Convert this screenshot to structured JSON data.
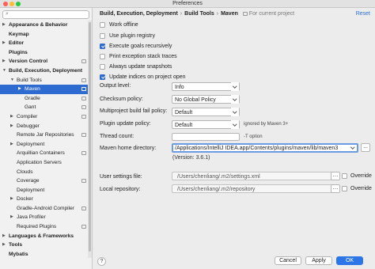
{
  "window": {
    "title": "Preferences"
  },
  "sidebar": {
    "items": [
      {
        "label": "Appearance & Behavior",
        "bold": true,
        "arrow": "▶",
        "indent": 0,
        "proj": false,
        "selected": false
      },
      {
        "label": "Keymap",
        "bold": true,
        "arrow": "",
        "indent": 0,
        "proj": false,
        "selected": false
      },
      {
        "label": "Editor",
        "bold": true,
        "arrow": "▶",
        "indent": 0,
        "proj": false,
        "selected": false
      },
      {
        "label": "Plugins",
        "bold": true,
        "arrow": "",
        "indent": 0,
        "proj": false,
        "selected": false
      },
      {
        "label": "Version Control",
        "bold": true,
        "arrow": "▶",
        "indent": 0,
        "proj": true,
        "selected": false
      },
      {
        "label": "Build, Execution, Deployment",
        "bold": true,
        "arrow": "▼",
        "indent": 0,
        "proj": false,
        "selected": false
      },
      {
        "label": "Build Tools",
        "bold": false,
        "arrow": "▼",
        "indent": 1,
        "proj": true,
        "selected": false
      },
      {
        "label": "Maven",
        "bold": false,
        "arrow": "▶",
        "indent": 2,
        "proj": true,
        "selected": true
      },
      {
        "label": "Gradle",
        "bold": false,
        "arrow": "",
        "indent": 2,
        "proj": true,
        "selected": false
      },
      {
        "label": "Gant",
        "bold": false,
        "arrow": "",
        "indent": 2,
        "proj": true,
        "selected": false
      },
      {
        "label": "Compiler",
        "bold": false,
        "arrow": "▶",
        "indent": 1,
        "proj": true,
        "selected": false
      },
      {
        "label": "Debugger",
        "bold": false,
        "arrow": "▶",
        "indent": 1,
        "proj": false,
        "selected": false
      },
      {
        "label": "Remote Jar Repositories",
        "bold": false,
        "arrow": "",
        "indent": 1,
        "proj": true,
        "selected": false
      },
      {
        "label": "Deployment",
        "bold": false,
        "arrow": "▶",
        "indent": 1,
        "proj": false,
        "selected": false
      },
      {
        "label": "Arquillian Containers",
        "bold": false,
        "arrow": "",
        "indent": 1,
        "proj": true,
        "selected": false
      },
      {
        "label": "Application Servers",
        "bold": false,
        "arrow": "",
        "indent": 1,
        "proj": false,
        "selected": false
      },
      {
        "label": "Clouds",
        "bold": false,
        "arrow": "",
        "indent": 1,
        "proj": false,
        "selected": false
      },
      {
        "label": "Coverage",
        "bold": false,
        "arrow": "",
        "indent": 1,
        "proj": true,
        "selected": false
      },
      {
        "label": "Deployment",
        "bold": false,
        "arrow": "",
        "indent": 1,
        "proj": false,
        "selected": false
      },
      {
        "label": "Docker",
        "bold": false,
        "arrow": "▶",
        "indent": 1,
        "proj": false,
        "selected": false
      },
      {
        "label": "Gradle-Android Compiler",
        "bold": false,
        "arrow": "",
        "indent": 1,
        "proj": true,
        "selected": false
      },
      {
        "label": "Java Profiler",
        "bold": false,
        "arrow": "▶",
        "indent": 1,
        "proj": false,
        "selected": false
      },
      {
        "label": "Required Plugins",
        "bold": false,
        "arrow": "",
        "indent": 1,
        "proj": true,
        "selected": false
      },
      {
        "label": "Languages & Frameworks",
        "bold": true,
        "arrow": "▶",
        "indent": 0,
        "proj": false,
        "selected": false
      },
      {
        "label": "Tools",
        "bold": true,
        "arrow": "▶",
        "indent": 0,
        "proj": false,
        "selected": false
      },
      {
        "label": "Mybatis",
        "bold": true,
        "arrow": "",
        "indent": 0,
        "proj": false,
        "selected": false
      }
    ]
  },
  "breadcrumb": {
    "part1": "Build, Execution, Deployment",
    "sep1": "›",
    "part2": "Build Tools",
    "sep2": "›",
    "part3": "Maven",
    "note": "For current project"
  },
  "reset_label": "Reset",
  "checkboxes": [
    {
      "label": "Work offline",
      "checked": false
    },
    {
      "label": "Use plugin registry",
      "checked": false
    },
    {
      "label": "Execute goals recursively",
      "checked": true
    },
    {
      "label": "Print exception stack traces",
      "checked": false
    },
    {
      "label": "Always update snapshots",
      "checked": false
    },
    {
      "label": "Update indices on project open",
      "checked": true
    }
  ],
  "fields": {
    "output_level": {
      "label": "Output level:",
      "value": "Info"
    },
    "checksum_policy": {
      "label": "Checksum policy:",
      "value": "No Global Policy"
    },
    "multiproject_policy": {
      "label": "Multiproject build fail policy:",
      "value": "Default"
    },
    "plugin_update_policy": {
      "label": "Plugin update policy:",
      "value": "Default",
      "note": "ignored by Maven 3+"
    },
    "thread_count": {
      "label": "Thread count:",
      "value": "",
      "note": "-T option"
    },
    "maven_home": {
      "label": "Maven home directory:",
      "value": "/Applications/IntelliJ IDEA.app/Contents/plugins/maven/lib/maven3",
      "version": "(Version: 3.6.1)",
      "browse": "..."
    },
    "user_settings": {
      "label": "User settings file:",
      "value": "/Users/chenliang/.m2/settings.xml",
      "override": "Override"
    },
    "local_repository": {
      "label": "Local repository:",
      "value": "/Users/chenliang/.m2/repository",
      "override": "Override"
    }
  },
  "buttons": {
    "help": "?",
    "cancel": "Cancel",
    "apply": "Apply",
    "ok": "OK"
  },
  "colors": {
    "accent": "#2e6bd1",
    "link": "#2b6fd6"
  }
}
